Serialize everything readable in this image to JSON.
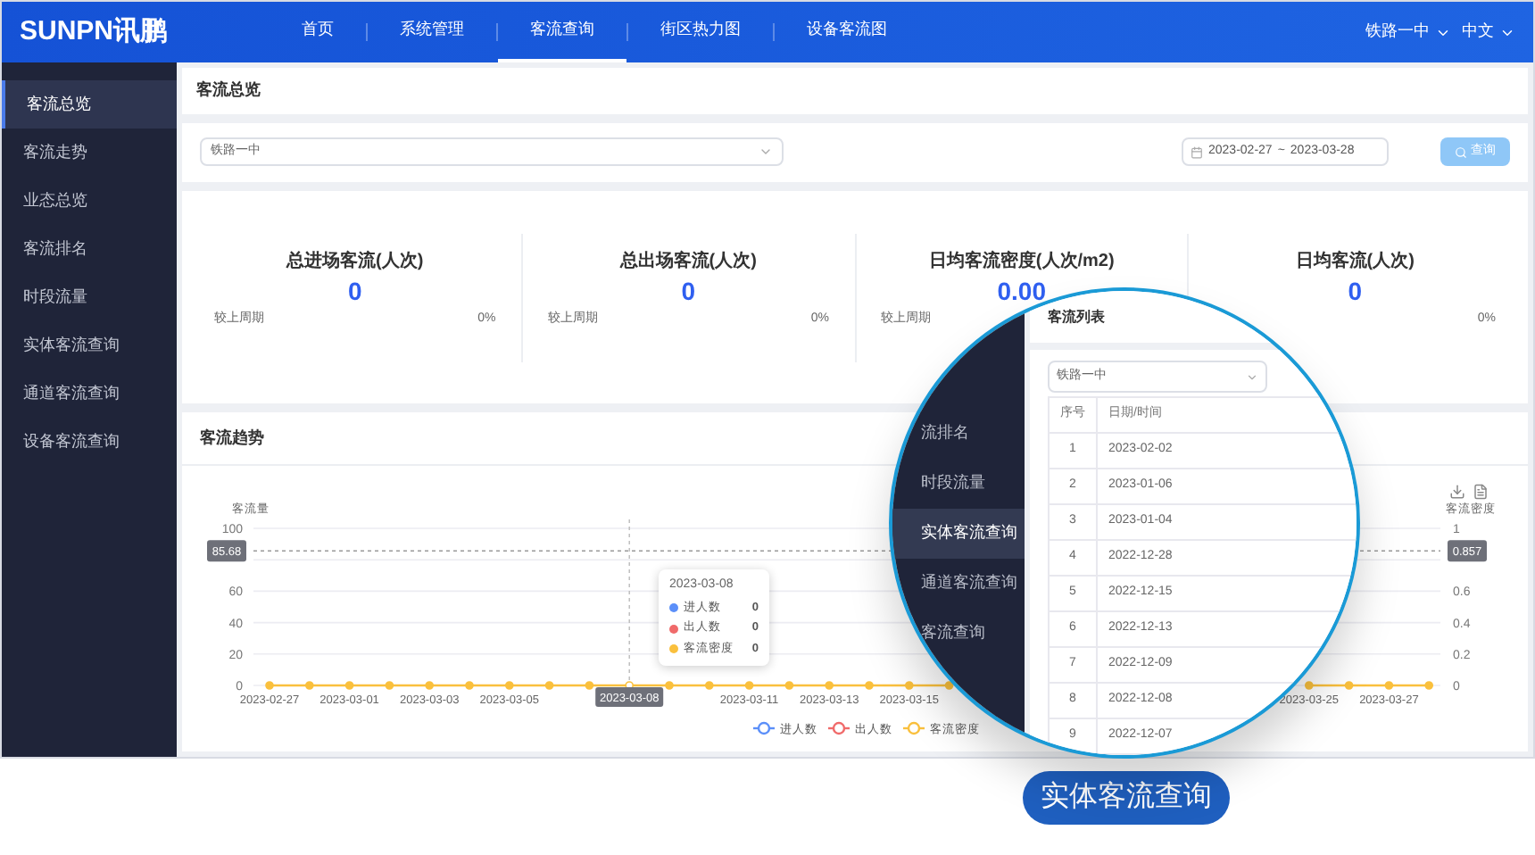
{
  "top_bar": {
    "logo": "SUNPN讯鹏",
    "nav": [
      {
        "label": "首页",
        "selected": false
      },
      {
        "label": "系统管理",
        "selected": false
      },
      {
        "label": "客流查询",
        "selected": true
      },
      {
        "label": "街区热力图",
        "selected": false
      },
      {
        "label": "设备客流图",
        "selected": false
      }
    ],
    "site": "铁路一中",
    "language": "中文"
  },
  "sidebar": {
    "items": [
      {
        "label": "客流总览",
        "selected": true
      },
      {
        "label": "客流走势",
        "selected": false
      },
      {
        "label": "业态总览",
        "selected": false
      },
      {
        "label": "客流排名",
        "selected": false
      },
      {
        "label": "时段流量",
        "selected": false
      },
      {
        "label": "实体客流查询",
        "selected": false
      },
      {
        "label": "通道客流查询",
        "selected": false
      },
      {
        "label": "设备客流查询",
        "selected": false
      }
    ]
  },
  "page_title": "客流总览",
  "filter": {
    "site": "铁路一中",
    "date_from": "2023-02-27",
    "date_sep": "~",
    "date_to": "2023-03-28",
    "search_button": "查询"
  },
  "stats": [
    {
      "title": "总进场客流(人次)",
      "value": "0",
      "compare_label": "较上周期",
      "change": "0%"
    },
    {
      "title": "总出场客流(人次)",
      "value": "0",
      "compare_label": "较上周期",
      "change": "0%"
    },
    {
      "title": "日均客流密度(人次/m2)",
      "value": "0.00",
      "compare_label": "较上周期"
    },
    {
      "title": "日均客流(人次)",
      "value": "0",
      "change": "0%"
    }
  ],
  "trend": {
    "title": "客流趋势",
    "chart_data": {
      "type": "line",
      "categories": [
        "2023-02-27",
        null,
        "2023-03-01",
        null,
        "2023-03-03",
        null,
        "2023-03-05",
        null,
        null,
        "2023-03-08",
        null,
        null,
        "2023-03-11",
        null,
        "2023-03-13",
        null,
        "2023-03-15",
        null,
        null,
        null,
        null,
        null,
        null,
        null,
        null,
        null,
        "2023-03-25",
        null,
        "2023-03-27",
        null
      ],
      "series": [
        {
          "name": "进人数",
          "color": "#5b8ff9",
          "marker": "circle",
          "values": [
            null,
            null,
            null,
            null,
            null,
            null,
            null,
            null,
            null,
            null,
            null,
            null,
            null,
            null,
            null,
            null,
            null,
            null,
            null,
            null,
            null,
            null,
            null,
            null,
            null,
            null,
            null,
            null,
            null,
            null
          ]
        },
        {
          "name": "出人数",
          "color": "#f06a6a",
          "marker": "circle",
          "values": [
            null,
            null,
            null,
            null,
            null,
            null,
            null,
            null,
            null,
            null,
            null,
            null,
            null,
            null,
            null,
            null,
            null,
            null,
            null,
            null,
            null,
            null,
            null,
            null,
            null,
            null,
            null,
            null,
            null,
            null
          ]
        },
        {
          "name": "客流密度",
          "color": "#fac03d",
          "marker": "circle",
          "values": [
            0,
            0,
            0,
            0,
            0,
            0,
            0,
            0,
            0,
            0,
            0,
            0,
            0,
            0,
            0,
            0,
            0,
            0,
            null,
            null,
            null,
            null,
            null,
            null,
            null,
            null,
            0,
            0,
            0,
            0
          ]
        }
      ],
      "ylabel": "客流量",
      "ylim": [
        0,
        100
      ],
      "yticks": [
        0,
        20,
        40,
        60,
        100
      ],
      "y2label": "客流密度",
      "y2lim": [
        0,
        1
      ],
      "y2ticks": [
        0,
        0.2,
        0.4,
        0.6,
        1
      ],
      "grid": true,
      "legend": true,
      "ref_lines": [
        {
          "axis": "x",
          "value": "2023-03-08"
        },
        {
          "axis": "y",
          "value": 85.68,
          "label": "85.68"
        }
      ]
    },
    "right_axis_pointer": "0.857",
    "tooltip": {
      "title": "2023-03-08",
      "rows": [
        {
          "name": "进人数",
          "value": "0",
          "color": "#5b8ff9"
        },
        {
          "name": "出人数",
          "value": "0",
          "color": "#f06a6a"
        },
        {
          "name": "客流密度",
          "value": "0",
          "color": "#fac03d"
        }
      ]
    }
  },
  "magnifier": {
    "sidebar": [
      {
        "label": "流排名",
        "selected": false
      },
      {
        "label": "时段流量",
        "selected": false
      },
      {
        "label": "实体客流查询",
        "selected": true
      },
      {
        "label": "通道客流查询",
        "selected": false
      },
      {
        "label": "客流查询",
        "selected": false
      }
    ],
    "panel_title": "客流列表",
    "select": "铁路一中",
    "columns": [
      "序号",
      "日期/时间"
    ],
    "rows": [
      [
        "1",
        "2023-02-02"
      ],
      [
        "2",
        "2023-01-06"
      ],
      [
        "3",
        "2023-01-04"
      ],
      [
        "4",
        "2022-12-28"
      ],
      [
        "5",
        "2022-12-15"
      ],
      [
        "6",
        "2022-12-13"
      ],
      [
        "7",
        "2022-12-09"
      ],
      [
        "8",
        "2022-12-08"
      ],
      [
        "9",
        "2022-12-07"
      ]
    ]
  },
  "caption": "实体客流查询"
}
